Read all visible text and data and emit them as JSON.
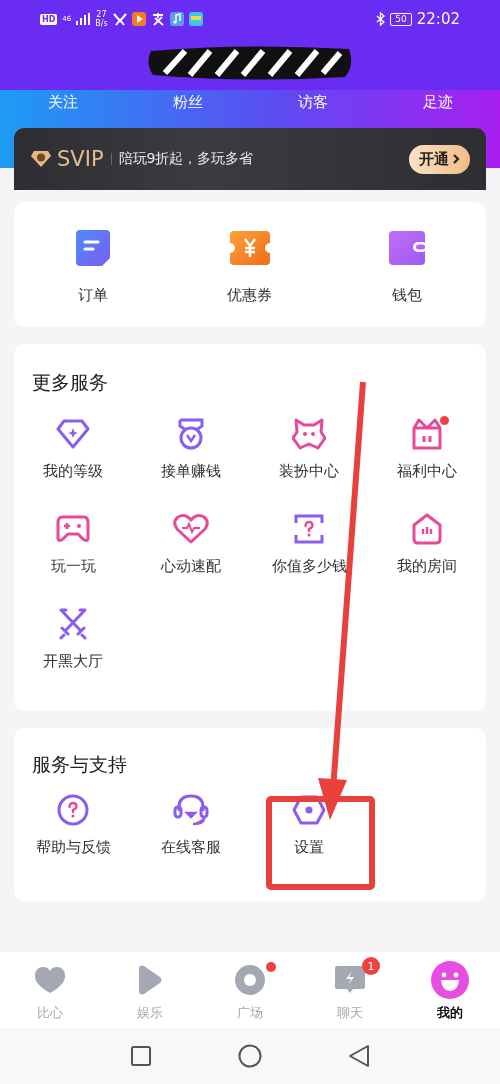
{
  "status_bar": {
    "hd": "HD",
    "network": "46",
    "speed": "27",
    "speed_unit": "B/s",
    "battery": "50",
    "time": "22:02"
  },
  "stats_tabs": [
    {
      "label": "关注"
    },
    {
      "label": "粉丝"
    },
    {
      "label": "访客"
    },
    {
      "label": "足迹"
    }
  ],
  "vip": {
    "badge": "SVIP",
    "text": "陪玩9折起，多玩多省",
    "button": "开通"
  },
  "quick_links": [
    {
      "label": "订单",
      "kind": "order"
    },
    {
      "label": "优惠券",
      "kind": "coupon"
    },
    {
      "label": "钱包",
      "kind": "wallet"
    }
  ],
  "more_services": {
    "title": "更多服务",
    "items": [
      {
        "label": "我的等级",
        "kind": "level",
        "dot": false
      },
      {
        "label": "接单赚钱",
        "kind": "medal",
        "dot": false
      },
      {
        "label": "装扮中心",
        "kind": "cat",
        "dot": false
      },
      {
        "label": "福利中心",
        "kind": "gift",
        "dot": true
      },
      {
        "label": "玩一玩",
        "kind": "gamepad",
        "dot": false
      },
      {
        "label": "心动速配",
        "kind": "heart",
        "dot": false
      },
      {
        "label": "你值多少钱",
        "kind": "question",
        "dot": false
      },
      {
        "label": "我的房间",
        "kind": "house",
        "dot": false
      },
      {
        "label": "开黑大厅",
        "kind": "swords",
        "dot": false
      }
    ]
  },
  "support": {
    "title": "服务与支持",
    "items": [
      {
        "label": "帮助与反馈",
        "kind": "help"
      },
      {
        "label": "在线客服",
        "kind": "headset"
      },
      {
        "label": "设置",
        "kind": "settings"
      }
    ]
  },
  "bottom_nav": [
    {
      "label": "比心",
      "kind": "heart",
      "selected": false,
      "dot": false
    },
    {
      "label": "娱乐",
      "kind": "play",
      "selected": false,
      "dot": false
    },
    {
      "label": "广场",
      "kind": "disc",
      "selected": false,
      "dot": true
    },
    {
      "label": "聊天",
      "kind": "chat",
      "selected": false,
      "dot": false,
      "count": "1"
    },
    {
      "label": "我的",
      "kind": "smile",
      "selected": true,
      "dot": false
    }
  ]
}
